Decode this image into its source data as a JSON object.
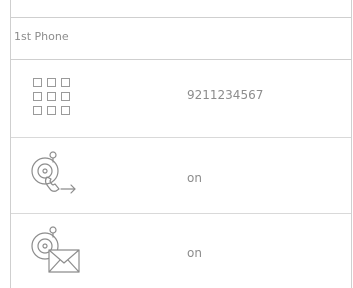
{
  "phone_panel": {
    "title": "1st Phone",
    "number_row": {
      "icon": "keypad-icon",
      "value": "9211234567"
    },
    "forward_row": {
      "icon": "call-forward-icon",
      "value": "on"
    },
    "voicemail_row": {
      "icon": "voicemail-icon",
      "value": "on"
    }
  }
}
